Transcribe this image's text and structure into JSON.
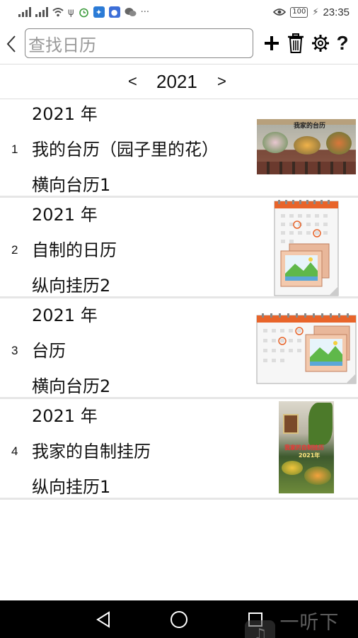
{
  "status_bar": {
    "battery": "100",
    "time": "23:35",
    "more": "···"
  },
  "toolbar": {
    "search_placeholder": "查找日历"
  },
  "year_nav": {
    "prev": "<",
    "year": "2021",
    "next": ">"
  },
  "calendars": [
    {
      "index": "1",
      "year": "2021 年",
      "name": "我的台历（园子里的花）",
      "type": "横向台历1",
      "thumb_title": "我家的台历"
    },
    {
      "index": "2",
      "year": "2021 年",
      "name": "自制的日历",
      "type": "纵向挂历2"
    },
    {
      "index": "3",
      "year": "2021 年",
      "name": "台历",
      "type": "横向台历2"
    },
    {
      "index": "4",
      "year": "2021 年",
      "name": "我家的自制挂历",
      "type": "纵向挂历1",
      "thumb_title": "我家的自制挂历",
      "thumb_year": "2021年"
    }
  ],
  "watermark": "一听下载",
  "colors": {
    "accent_orange": "#e8642a",
    "divider": "#e6e6e6",
    "nav_bg": "#000000"
  }
}
